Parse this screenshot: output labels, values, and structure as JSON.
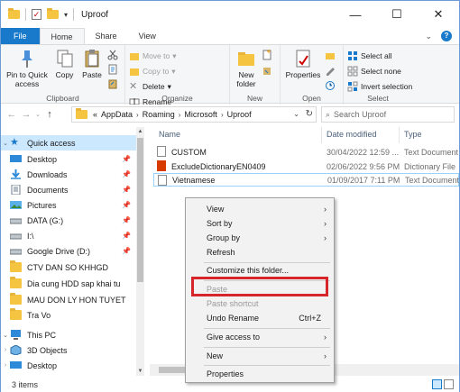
{
  "window": {
    "title": "Uproof"
  },
  "tabs": [
    "File",
    "Home",
    "Share",
    "View"
  ],
  "ribbon": {
    "clipboard": {
      "label": "Clipboard",
      "pin": "Pin to Quick access",
      "copy": "Copy",
      "paste": "Paste"
    },
    "organize": {
      "label": "Organize",
      "move_to": "Move to",
      "copy_to": "Copy to",
      "delete": "Delete",
      "rename": "Rename"
    },
    "new": {
      "label": "New",
      "new_folder": "New folder"
    },
    "open": {
      "label": "Open",
      "properties": "Properties"
    },
    "select": {
      "label": "Select",
      "select_all": "Select all",
      "select_none": "Select none",
      "invert": "Invert selection"
    }
  },
  "address": {
    "prefix": "«",
    "crumbs": [
      "AppData",
      "Roaming",
      "Microsoft",
      "Uproof"
    ]
  },
  "search": {
    "placeholder": "Search Uproof"
  },
  "nav": [
    {
      "label": "Quick access",
      "icon": "star-icon",
      "selected": true,
      "chevron": "v",
      "pinned": false
    },
    {
      "label": "Desktop",
      "icon": "desktop-icon",
      "pinned": true
    },
    {
      "label": "Downloads",
      "icon": "download-icon",
      "pinned": true
    },
    {
      "label": "Documents",
      "icon": "documents-icon",
      "pinned": true
    },
    {
      "label": "Pictures",
      "icon": "pictures-icon",
      "pinned": true
    },
    {
      "label": "DATA (G:)",
      "icon": "drive-icon",
      "pinned": true
    },
    {
      "label": "I:\\",
      "icon": "drive-icon",
      "pinned": true
    },
    {
      "label": "Google Drive (D:)",
      "icon": "drive-icon",
      "pinned": true
    },
    {
      "label": "CTV DAN SO KHHGD",
      "icon": "folder-icon",
      "pinned": false
    },
    {
      "label": "Dia cung HDD sap khai tu",
      "icon": "folder-icon",
      "pinned": false
    },
    {
      "label": "MAU DON LY HON TUYET",
      "icon": "folder-icon",
      "pinned": false
    },
    {
      "label": "Tra Vo",
      "icon": "folder-icon",
      "pinned": false
    },
    {
      "label": "This PC",
      "icon": "pc-icon",
      "pinned": false,
      "chevron": ">"
    },
    {
      "label": "3D Objects",
      "icon": "3d-icon",
      "pinned": false
    },
    {
      "label": "Desktop",
      "icon": "desktop-icon",
      "pinned": false
    }
  ],
  "columns": [
    "Name",
    "Date modified",
    "Type"
  ],
  "files": [
    {
      "name": "CUSTOM",
      "date": "30/04/2022 12:59 ...",
      "type": "Text Document",
      "icon": "text-file-icon"
    },
    {
      "name": "ExcludeDictionaryEN0409",
      "date": "02/06/2022 9:56 PM",
      "type": "Dictionary File",
      "icon": "office-file-icon"
    },
    {
      "name": "Vietnamese",
      "date": "01/09/2017 7:11 PM",
      "type": "Text Document",
      "icon": "text-file-icon"
    }
  ],
  "status": {
    "items": "3 items"
  },
  "context_menu": [
    {
      "label": "View",
      "arrow": true
    },
    {
      "label": "Sort by",
      "arrow": true
    },
    {
      "label": "Group by",
      "arrow": true
    },
    {
      "label": "Refresh"
    },
    {
      "sep": true
    },
    {
      "label": "Customize this folder..."
    },
    {
      "sep": true
    },
    {
      "label": "Paste",
      "disabled": true
    },
    {
      "label": "Paste shortcut",
      "disabled": true
    },
    {
      "label": "Undo Rename",
      "shortcut": "Ctrl+Z"
    },
    {
      "sep": true
    },
    {
      "label": "Give access to",
      "arrow": true
    },
    {
      "sep": true
    },
    {
      "label": "New",
      "arrow": true
    },
    {
      "sep": true
    },
    {
      "label": "Properties"
    }
  ],
  "colors": {
    "accent": "#1979ca",
    "selection": "#cce8ff",
    "highlight_box": "#d6262c"
  }
}
